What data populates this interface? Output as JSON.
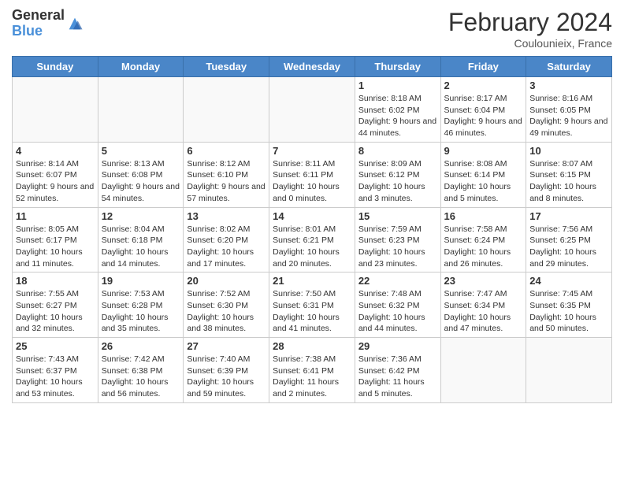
{
  "header": {
    "logo_general": "General",
    "logo_blue": "Blue",
    "month_title": "February 2024",
    "location": "Coulounieix, France"
  },
  "days_of_week": [
    "Sunday",
    "Monday",
    "Tuesday",
    "Wednesday",
    "Thursday",
    "Friday",
    "Saturday"
  ],
  "weeks": [
    [
      {
        "day": "",
        "info": ""
      },
      {
        "day": "",
        "info": ""
      },
      {
        "day": "",
        "info": ""
      },
      {
        "day": "",
        "info": ""
      },
      {
        "day": "1",
        "info": "Sunrise: 8:18 AM\nSunset: 6:02 PM\nDaylight: 9 hours and 44 minutes."
      },
      {
        "day": "2",
        "info": "Sunrise: 8:17 AM\nSunset: 6:04 PM\nDaylight: 9 hours and 46 minutes."
      },
      {
        "day": "3",
        "info": "Sunrise: 8:16 AM\nSunset: 6:05 PM\nDaylight: 9 hours and 49 minutes."
      }
    ],
    [
      {
        "day": "4",
        "info": "Sunrise: 8:14 AM\nSunset: 6:07 PM\nDaylight: 9 hours and 52 minutes."
      },
      {
        "day": "5",
        "info": "Sunrise: 8:13 AM\nSunset: 6:08 PM\nDaylight: 9 hours and 54 minutes."
      },
      {
        "day": "6",
        "info": "Sunrise: 8:12 AM\nSunset: 6:10 PM\nDaylight: 9 hours and 57 minutes."
      },
      {
        "day": "7",
        "info": "Sunrise: 8:11 AM\nSunset: 6:11 PM\nDaylight: 10 hours and 0 minutes."
      },
      {
        "day": "8",
        "info": "Sunrise: 8:09 AM\nSunset: 6:12 PM\nDaylight: 10 hours and 3 minutes."
      },
      {
        "day": "9",
        "info": "Sunrise: 8:08 AM\nSunset: 6:14 PM\nDaylight: 10 hours and 5 minutes."
      },
      {
        "day": "10",
        "info": "Sunrise: 8:07 AM\nSunset: 6:15 PM\nDaylight: 10 hours and 8 minutes."
      }
    ],
    [
      {
        "day": "11",
        "info": "Sunrise: 8:05 AM\nSunset: 6:17 PM\nDaylight: 10 hours and 11 minutes."
      },
      {
        "day": "12",
        "info": "Sunrise: 8:04 AM\nSunset: 6:18 PM\nDaylight: 10 hours and 14 minutes."
      },
      {
        "day": "13",
        "info": "Sunrise: 8:02 AM\nSunset: 6:20 PM\nDaylight: 10 hours and 17 minutes."
      },
      {
        "day": "14",
        "info": "Sunrise: 8:01 AM\nSunset: 6:21 PM\nDaylight: 10 hours and 20 minutes."
      },
      {
        "day": "15",
        "info": "Sunrise: 7:59 AM\nSunset: 6:23 PM\nDaylight: 10 hours and 23 minutes."
      },
      {
        "day": "16",
        "info": "Sunrise: 7:58 AM\nSunset: 6:24 PM\nDaylight: 10 hours and 26 minutes."
      },
      {
        "day": "17",
        "info": "Sunrise: 7:56 AM\nSunset: 6:25 PM\nDaylight: 10 hours and 29 minutes."
      }
    ],
    [
      {
        "day": "18",
        "info": "Sunrise: 7:55 AM\nSunset: 6:27 PM\nDaylight: 10 hours and 32 minutes."
      },
      {
        "day": "19",
        "info": "Sunrise: 7:53 AM\nSunset: 6:28 PM\nDaylight: 10 hours and 35 minutes."
      },
      {
        "day": "20",
        "info": "Sunrise: 7:52 AM\nSunset: 6:30 PM\nDaylight: 10 hours and 38 minutes."
      },
      {
        "day": "21",
        "info": "Sunrise: 7:50 AM\nSunset: 6:31 PM\nDaylight: 10 hours and 41 minutes."
      },
      {
        "day": "22",
        "info": "Sunrise: 7:48 AM\nSunset: 6:32 PM\nDaylight: 10 hours and 44 minutes."
      },
      {
        "day": "23",
        "info": "Sunrise: 7:47 AM\nSunset: 6:34 PM\nDaylight: 10 hours and 47 minutes."
      },
      {
        "day": "24",
        "info": "Sunrise: 7:45 AM\nSunset: 6:35 PM\nDaylight: 10 hours and 50 minutes."
      }
    ],
    [
      {
        "day": "25",
        "info": "Sunrise: 7:43 AM\nSunset: 6:37 PM\nDaylight: 10 hours and 53 minutes."
      },
      {
        "day": "26",
        "info": "Sunrise: 7:42 AM\nSunset: 6:38 PM\nDaylight: 10 hours and 56 minutes."
      },
      {
        "day": "27",
        "info": "Sunrise: 7:40 AM\nSunset: 6:39 PM\nDaylight: 10 hours and 59 minutes."
      },
      {
        "day": "28",
        "info": "Sunrise: 7:38 AM\nSunset: 6:41 PM\nDaylight: 11 hours and 2 minutes."
      },
      {
        "day": "29",
        "info": "Sunrise: 7:36 AM\nSunset: 6:42 PM\nDaylight: 11 hours and 5 minutes."
      },
      {
        "day": "",
        "info": ""
      },
      {
        "day": "",
        "info": ""
      }
    ]
  ]
}
